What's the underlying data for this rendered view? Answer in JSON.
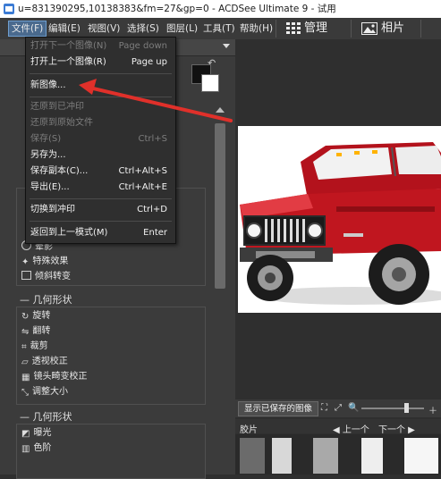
{
  "window": {
    "title": "u=831390295,10138383&fm=27&gp=0 - ACDSee Ultimate 9 - 试用"
  },
  "menubar": {
    "items": [
      "文件(F)",
      "编辑(E)",
      "视图(V)",
      "选择(S)",
      "图层(L)",
      "工具(T)",
      "帮助(H)"
    ],
    "mode_manage": "管理",
    "mode_photos": "相片"
  },
  "file_menu": {
    "items": [
      {
        "label": "打开下一个图像(N)",
        "shortcut": "Page down",
        "enabled": false
      },
      {
        "label": "打开上一个图像(R)",
        "shortcut": "Page up",
        "enabled": true
      },
      {
        "label": "新图像...",
        "shortcut": "",
        "enabled": true
      },
      {
        "label": "还原到已冲印",
        "shortcut": "",
        "enabled": false
      },
      {
        "label": "还原到原始文件",
        "shortcut": "",
        "enabled": false
      },
      {
        "label": "保存(S)",
        "shortcut": "Ctrl+S",
        "enabled": false
      },
      {
        "label": "另存为...",
        "shortcut": "",
        "enabled": true
      },
      {
        "label": "保存副本(C)...",
        "shortcut": "Ctrl+Alt+S",
        "enabled": true
      },
      {
        "label": "导出(E)...",
        "shortcut": "Ctrl+Alt+E",
        "enabled": true
      },
      {
        "label": "切换到冲印",
        "shortcut": "Ctrl+D",
        "enabled": true
      },
      {
        "label": "返回到上一模式(M)",
        "shortcut": "Enter",
        "enabled": true
      }
    ]
  },
  "left_panel": {
    "group1_items": [
      "晕影",
      "特殊效果",
      "倾斜转变"
    ],
    "section2_title": "几何形状",
    "group2_items": [
      "旋转",
      "翻转",
      "裁剪",
      "透视校正",
      "镜头畸变校正",
      "调整大小"
    ],
    "section3_title": "几何形状",
    "group3_items": [
      "曝光",
      "色阶"
    ]
  },
  "viewer": {
    "saved_image_button": "显示已保存的图像",
    "filmstrip_label": "胶片",
    "prev_label": "上一个",
    "next_label": "下一个"
  },
  "colors": {
    "arrow": "#e0302a",
    "menu_active": "#4a6a8e",
    "car_body": "#c0161f"
  },
  "icons": {
    "app": "acdsee-app-icon",
    "manage_mode": "grid-icon",
    "photos_mode": "photo-icon"
  }
}
